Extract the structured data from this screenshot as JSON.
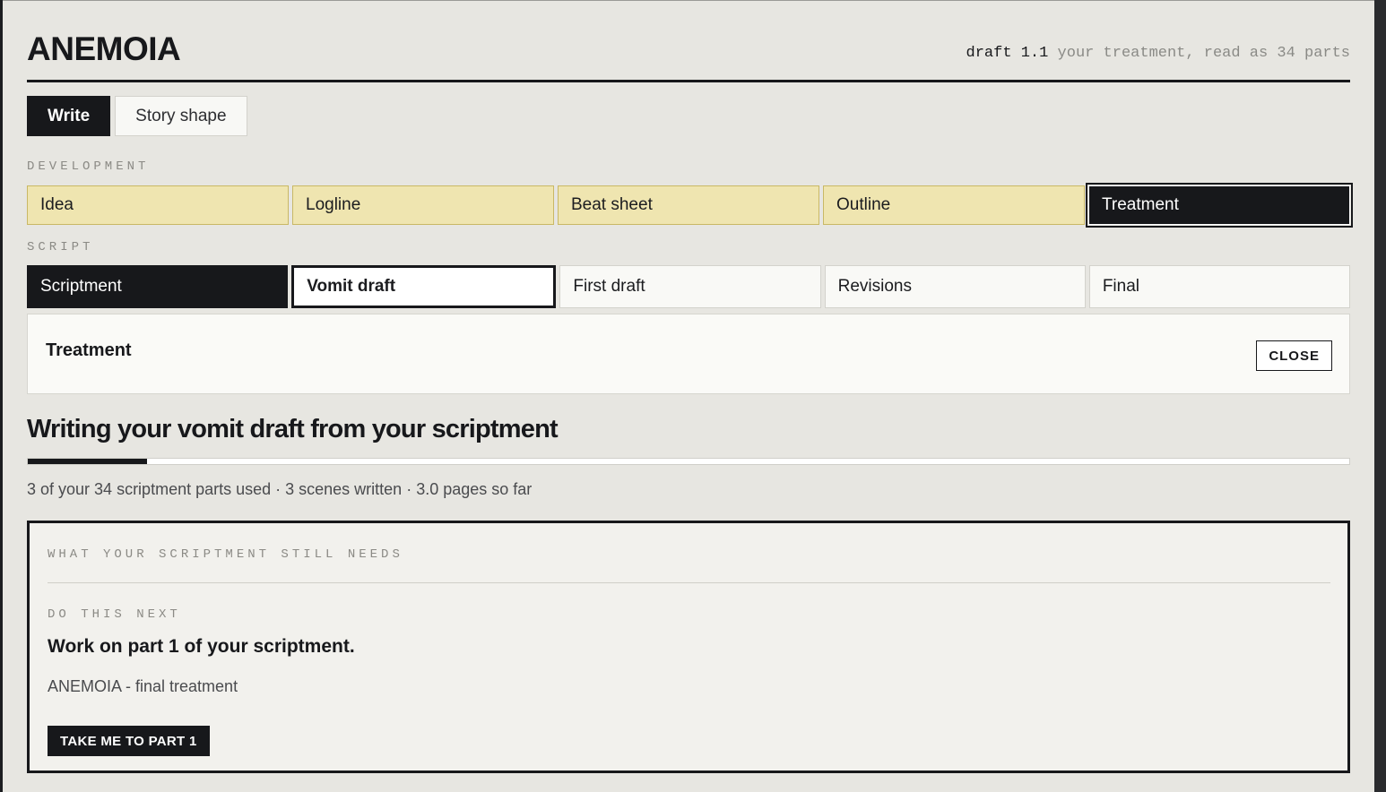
{
  "app": {
    "title": "ANEMOIA",
    "version": "draft 1.1",
    "meta_text": "your treatment, read as 34 parts"
  },
  "modes": [
    {
      "label": "Write",
      "active": true
    },
    {
      "label": "Story shape",
      "active": false
    }
  ],
  "development": {
    "label": "DEVELOPMENT",
    "stages": [
      "Idea",
      "Logline",
      "Beat sheet",
      "Outline",
      "Treatment"
    ]
  },
  "script": {
    "label": "SCRIPT",
    "stages": [
      "Scriptment",
      "Vomit draft",
      "First draft",
      "Revisions",
      "Final"
    ]
  },
  "panel": {
    "title": "Treatment",
    "close_label": "CLOSE"
  },
  "progress": {
    "heading": "Writing your vomit draft from your scriptment",
    "fraction": 0.09,
    "stats": "3 of your 34 scriptment parts used · 3 scenes written · 3.0 pages so far"
  },
  "needs": {
    "label": "WHAT YOUR SCRIPTMENT STILL NEEDS",
    "next_label": "DO THIS NEXT",
    "next_title": "Work on part 1 of your scriptment.",
    "next_sub": "ANEMOIA - final treatment",
    "cta_label": "TAKE ME TO PART 1"
  },
  "colors": {
    "ink": "#17181b",
    "background": "#e7e6e1",
    "development_stage": "#efe5b0"
  }
}
